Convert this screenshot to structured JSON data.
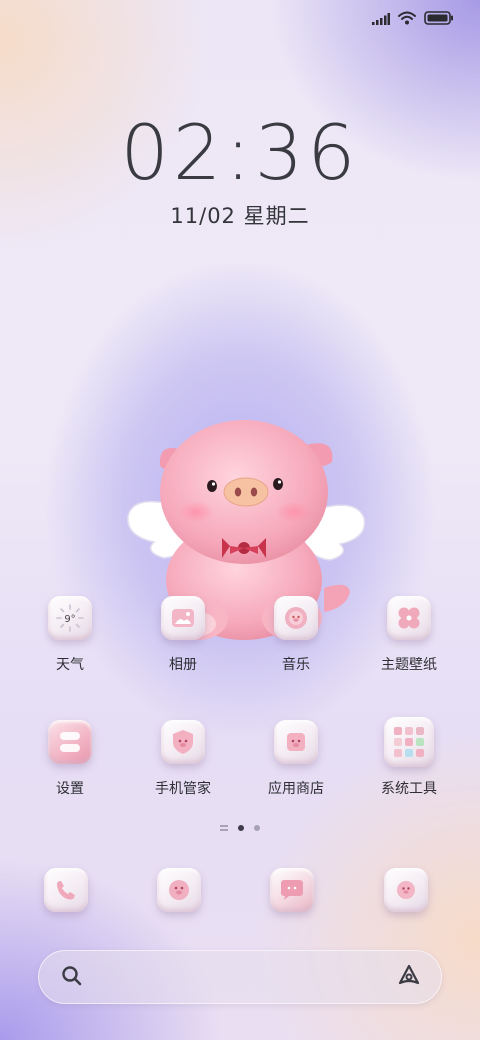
{
  "status_bar": {
    "icons": [
      "signal-icon",
      "wifi-icon",
      "battery-icon"
    ]
  },
  "lockscreen": {
    "time": "02:36",
    "date": "11/02 星期二"
  },
  "weather_widget": {
    "temp": "9°"
  },
  "apps_row1": [
    {
      "label": "天气",
      "icon": "weather-icon"
    },
    {
      "label": "相册",
      "icon": "gallery-icon"
    },
    {
      "label": "音乐",
      "icon": "music-icon"
    },
    {
      "label": "主题壁纸",
      "icon": "themes-icon"
    }
  ],
  "apps_row2": [
    {
      "label": "设置",
      "icon": "settings-icon"
    },
    {
      "label": "手机管家",
      "icon": "security-icon"
    },
    {
      "label": "应用商店",
      "icon": "app-store-icon"
    },
    {
      "label": "系统工具",
      "icon": "folder-icon"
    }
  ],
  "dock": [
    {
      "icon": "phone-icon"
    },
    {
      "icon": "messages-icon"
    },
    {
      "icon": "chat-icon"
    },
    {
      "icon": "camera-icon"
    }
  ],
  "page_indicator": {
    "pages": 2,
    "active": 1
  },
  "colors": {
    "icon_pink": "#e89bb0",
    "text": "#2e2e34",
    "accent_purple": "#b8b1f0"
  }
}
